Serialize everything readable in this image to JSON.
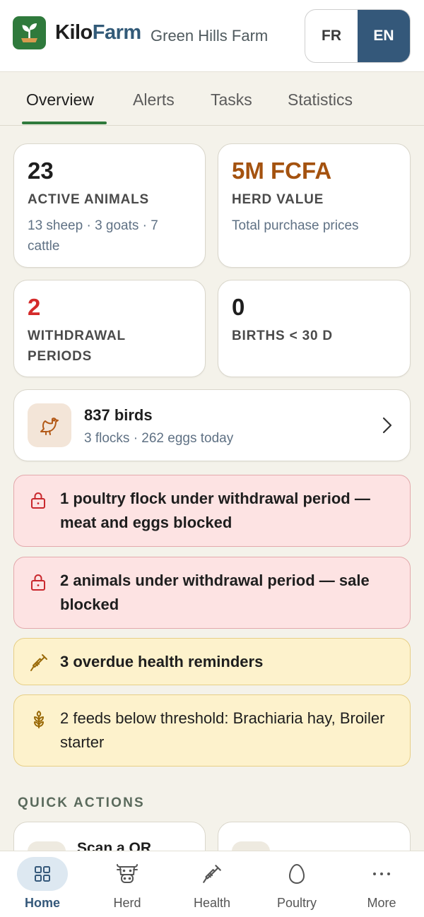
{
  "header": {
    "brand_kilo": "Kilo",
    "brand_farm": "Farm",
    "farm_name": "Green Hills Farm",
    "lang_fr": "FR",
    "lang_en": "EN"
  },
  "tabs": [
    "Overview",
    "Alerts",
    "Tasks",
    "Statistics"
  ],
  "stats": {
    "active": {
      "value": "23",
      "label": "ACTIVE ANIMALS",
      "sub": "13 sheep · 3 goats · 7 cattle"
    },
    "value": {
      "value": "5M FCFA",
      "label": "HERD VALUE",
      "sub": "Total purchase prices"
    },
    "withdrawal": {
      "value": "2",
      "label": "WITHDRAWAL PERIODS"
    },
    "births": {
      "value": "0",
      "label": "BIRTHS < 30 D"
    }
  },
  "birds": {
    "title": "837 birds",
    "sub": "3 flocks · 262 eggs today"
  },
  "alerts": [
    "1 poultry flock under withdrawal period — meat and eggs blocked",
    "2 animals under withdrawal period — sale blocked",
    "3 overdue health reminders",
    "2 feeds below threshold: Brachiaria hay, Broiler starter"
  ],
  "quick_actions": {
    "title": "QUICK ACTIONS",
    "scan_label": "Scan a QR"
  },
  "nav": [
    "Home",
    "Herd",
    "Health",
    "Poultry",
    "More"
  ],
  "colors": {
    "brand_green": "#2f7a3c",
    "brand_blue": "#34587a",
    "herd_value": "#a4520f",
    "withdrawal": "#d42a2a",
    "alert_red_bg": "#fde3e3",
    "alert_yellow_bg": "#fdf2cc"
  }
}
